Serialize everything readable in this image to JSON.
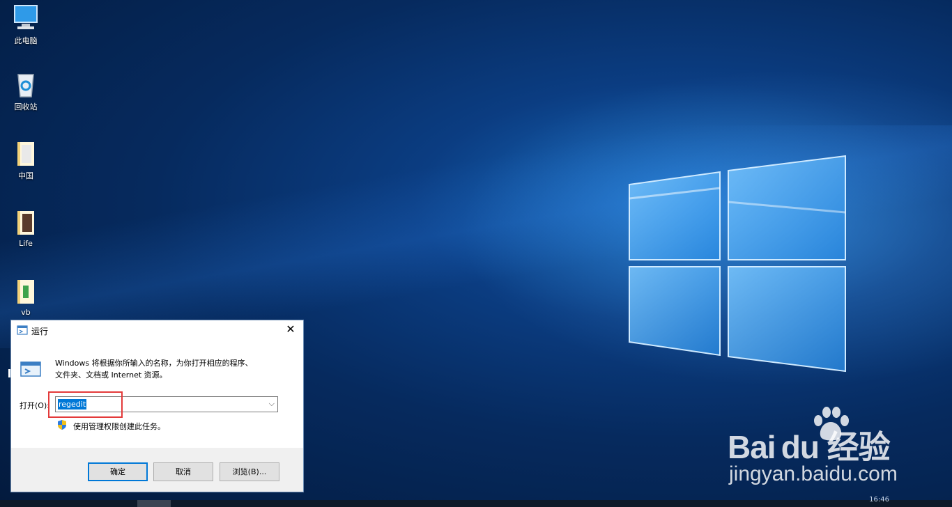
{
  "desktop": {
    "icons": [
      {
        "label": "此电脑",
        "icon": "computer-icon"
      },
      {
        "label": "回收站",
        "icon": "recycle-bin-icon"
      },
      {
        "label": "中国",
        "icon": "folder-icon"
      },
      {
        "label": "Life",
        "icon": "folder-icon"
      },
      {
        "label": "vb",
        "icon": "folder-icon"
      }
    ]
  },
  "run_dialog": {
    "title": "运行",
    "description_line1": "Windows 将根据你所输入的名称，为你打开相应的程序、",
    "description_line2": "文件夹、文档或 Internet 资源。",
    "open_label": "打开(O):",
    "command_value": "regedit",
    "admin_note": "使用管理权限创建此任务。",
    "buttons": {
      "ok": "确定",
      "cancel": "取消",
      "browse": "浏览(B)..."
    },
    "close_glyph": "✕"
  },
  "watermark": {
    "brand": "Bai du 经验",
    "url": "jingyan.baidu.com"
  },
  "taskbar": {
    "time": "16:46"
  },
  "colors": {
    "accent": "#0078d7",
    "highlight_box": "#e33a3a",
    "wallpaper_dark": "#031a3d",
    "wallpaper_light": "#1a6fc4"
  }
}
